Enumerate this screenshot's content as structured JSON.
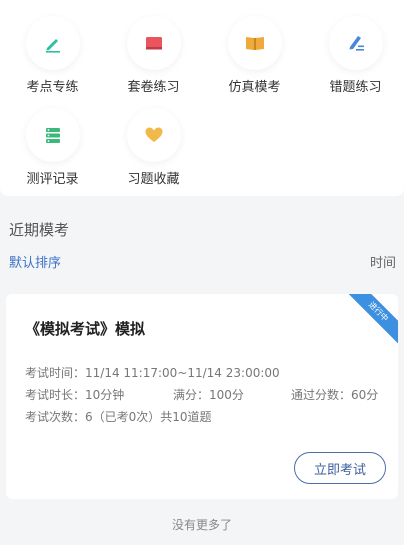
{
  "menu": {
    "items": [
      {
        "label": "考点专练",
        "icon": "pencil-icon",
        "color": "#2bbfa4"
      },
      {
        "label": "套卷练习",
        "icon": "book-icon",
        "color": "#e9545f"
      },
      {
        "label": "仿真模考",
        "icon": "open-book-icon",
        "color": "#f0a93b"
      },
      {
        "label": "错题练习",
        "icon": "edit-icon",
        "color": "#4a86d9"
      },
      {
        "label": "测评记录",
        "icon": "list-icon",
        "color": "#3bb87a"
      },
      {
        "label": "习题收藏",
        "icon": "heart-icon",
        "color": "#f0b94a"
      }
    ]
  },
  "recent": {
    "title": "近期模考",
    "sort_default": "默认排序",
    "sort_time": "时间"
  },
  "exam": {
    "status": "进行中",
    "title": "《模拟考试》模拟",
    "time_label": "考试时间：",
    "time_value": "11/14 11:17:00~11/14 23:00:00",
    "duration_label": "考试时长：",
    "duration_value": "10分钟",
    "full_label": "满分：",
    "full_value": "100分",
    "pass_label": "通过分数：",
    "pass_value": "60分",
    "count_label": "考试次数：",
    "count_value": "6（已考0次）共10道题",
    "start_button": "立即考试"
  },
  "footer": {
    "no_more": "没有更多了"
  }
}
